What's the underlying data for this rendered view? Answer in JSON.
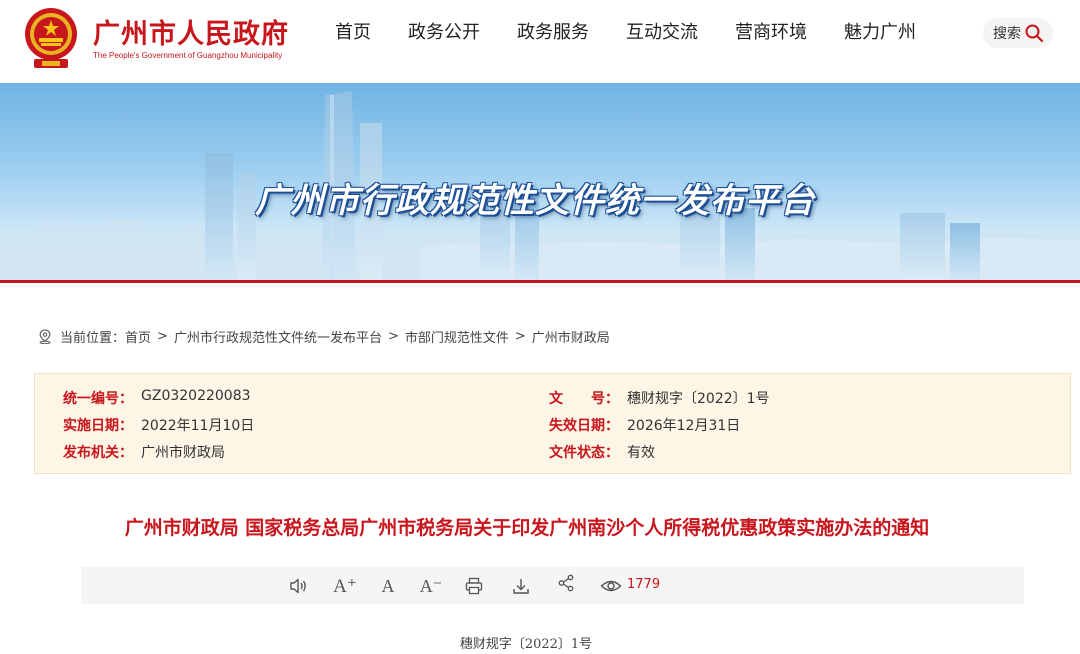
{
  "site": {
    "name": "广州市人民政府",
    "name_en": "The People's Government of Guangzhou Municipality"
  },
  "nav": {
    "items": [
      {
        "label": "首页"
      },
      {
        "label": "政务公开"
      },
      {
        "label": "政务服务"
      },
      {
        "label": "互动交流"
      },
      {
        "label": "营商环境"
      },
      {
        "label": "魅力广州"
      }
    ],
    "search_label": "搜索"
  },
  "banner": {
    "title": "广州市行政规范性文件统一发布平台"
  },
  "breadcrumb": {
    "prefix": "当前位置：",
    "items": [
      "首页",
      "广州市行政规范性文件统一发布平台",
      "市部门规范性文件",
      "广州市财政局"
    ],
    "separator": ">"
  },
  "meta": {
    "serial_label": "统一编号：",
    "serial_value": "GZ0320220083",
    "docnum_label": "文　　号：",
    "docnum_value": "穗财规字〔2022〕1号",
    "effective_label": "实施日期：",
    "effective_value": "2022年11月10日",
    "expiry_label": "失效日期：",
    "expiry_value": "2026年12月31日",
    "issuer_label": "发布机关：",
    "issuer_value": "广州市财政局",
    "status_label": "文件状态：",
    "status_value": "有效"
  },
  "document": {
    "title": "广州市财政局 国家税务总局广州市税务局关于印发广州南沙个人所得税优惠政策实施办法的通知",
    "doc_number": "穗财规字〔2022〕1号"
  },
  "toolbar": {
    "font_increase": "A⁺",
    "font_normal": "A",
    "font_decrease": "A⁻",
    "view_count": "1779"
  },
  "colors": {
    "brand_red": "#c8161d",
    "meta_bg": "#fdf5e6",
    "toolbar_bg": "#f5f5f5"
  }
}
